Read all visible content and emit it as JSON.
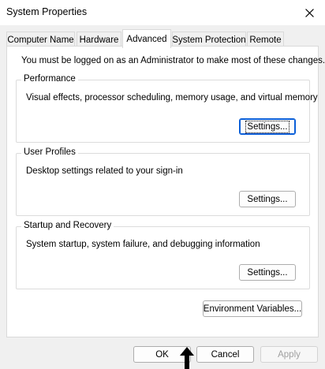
{
  "window": {
    "title": "System Properties"
  },
  "tabs": [
    {
      "label": "Computer Name"
    },
    {
      "label": "Hardware"
    },
    {
      "label": "Advanced",
      "active": true
    },
    {
      "label": "System Protection"
    },
    {
      "label": "Remote"
    }
  ],
  "panel": {
    "admin_note": "You must be logged on as an Administrator to make most of these changes.",
    "performance": {
      "label": "Performance",
      "description": "Visual effects, processor scheduling, memory usage, and virtual memory",
      "button": "Settings..."
    },
    "user_profiles": {
      "label": "User Profiles",
      "description": "Desktop settings related to your sign-in",
      "button": "Settings..."
    },
    "startup_recovery": {
      "label": "Startup and Recovery",
      "description": "System startup, system failure, and debugging information",
      "button": "Settings..."
    },
    "environment_button": "Environment Variables..."
  },
  "footer": {
    "ok": "OK",
    "cancel": "Cancel",
    "apply": "Apply"
  },
  "colors": {
    "window_bg": "#f0f0f0",
    "focus_border": "#0b5fd8",
    "disabled_text": "#a0a0a0"
  }
}
